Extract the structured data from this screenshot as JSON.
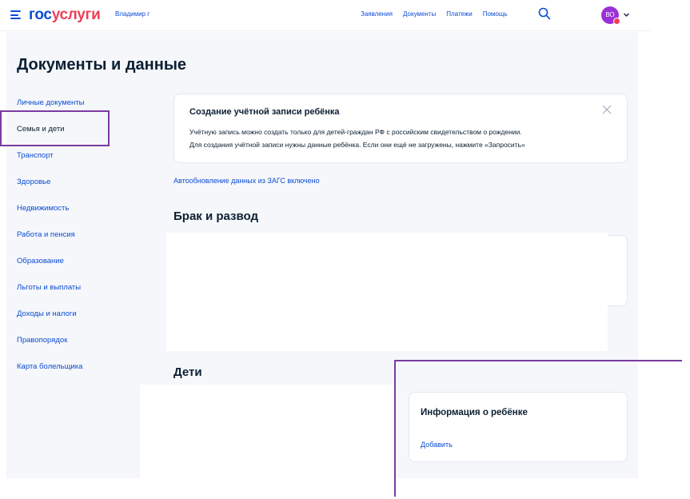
{
  "header": {
    "logo_part1": "гос",
    "logo_part2": "услуги",
    "user_name": "Владимир г",
    "nav": [
      "Заявления",
      "Документы",
      "Платежи",
      "Помощь"
    ],
    "avatar_initials": "ВО"
  },
  "page_title": "Документы и данные",
  "sidebar": {
    "items": [
      {
        "label": "Личные документы"
      },
      {
        "label": "Семья и дети"
      },
      {
        "label": "Транспорт"
      },
      {
        "label": "Здоровье"
      },
      {
        "label": "Недвижимость"
      },
      {
        "label": "Работа и пенсия"
      },
      {
        "label": "Образование"
      },
      {
        "label": "Льготы и выплаты"
      },
      {
        "label": "Доходы и налоги"
      },
      {
        "label": "Правопорядок"
      },
      {
        "label": "Карта болельщика"
      }
    ]
  },
  "info_card": {
    "title": "Создание учётной записи ребёнка",
    "line1": "Учётную запись можно создать только для детей-граждан РФ с российским свидетельством о рождении.",
    "line2": "Для создания учётной записи нужны данные ребёнка. Если они ещё не загружены, нажмите «Запросить»"
  },
  "autoupdate_link": "Автообновление данных из ЗАГС включено",
  "marriage_section": {
    "title": "Брак и развод"
  },
  "children_section": {
    "title": "Дети"
  },
  "child_card": {
    "title": "Информация о ребёнке",
    "add_label": "Добавить"
  },
  "colors": {
    "link_blue": "#0d4cd3",
    "brand_red": "#ee3f58",
    "highlight_purple": "#7b3aa0",
    "avatar_purple": "#9b30d9"
  }
}
